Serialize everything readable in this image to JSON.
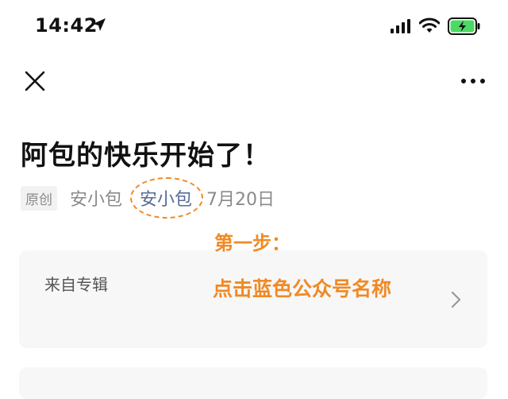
{
  "status_bar": {
    "time": "14:42"
  },
  "icons": {
    "location": "location-arrow-icon",
    "signal": "cellular-signal-icon",
    "wifi": "wifi-icon",
    "battery": "battery-charging-icon",
    "close": "close-icon",
    "more": "more-dots-icon",
    "chevron": "chevron-right-icon"
  },
  "article": {
    "title": "阿包的快乐开始了！",
    "badge": "原创",
    "author": "安小包",
    "account": "安小包",
    "date": "7月20日"
  },
  "annotation": {
    "step": "第一步：",
    "instruction": "点击蓝色公众号名称"
  },
  "album": {
    "label": "来自专辑"
  },
  "colors": {
    "link_blue": "#576b95",
    "annotation_orange": "#f08a24",
    "battery_green": "#4cd964"
  }
}
